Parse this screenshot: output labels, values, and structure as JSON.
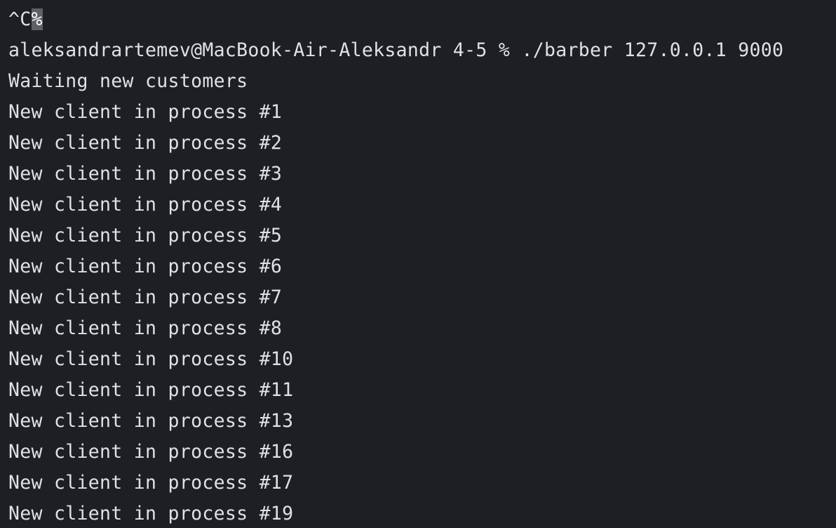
{
  "colors": {
    "background": "#1e1f22",
    "text": "#dfe1e5",
    "highlight": "#5f6066"
  },
  "terminal": {
    "interrupt_line": {
      "ctrl_text": "^C",
      "eol_mark": "%"
    },
    "prompt_line": "aleksandrartemev@MacBook-Air-Aleksandr 4-5 % ./barber 127.0.0.1 9000",
    "output_lines": [
      "Waiting new customers",
      "New client in process #1",
      "New client in process #2",
      "New client in process #3",
      "New client in process #4",
      "New client in process #5",
      "New client in process #6",
      "New client in process #7",
      "New client in process #8",
      "New client in process #10",
      "New client in process #11",
      "New client in process #13",
      "New client in process #16",
      "New client in process #17",
      "New client in process #19"
    ]
  }
}
